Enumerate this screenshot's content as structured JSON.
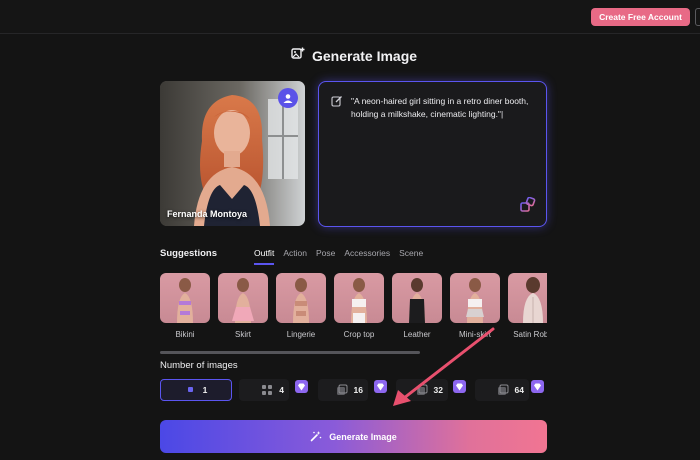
{
  "header": {
    "cta_label": "Create Free Account"
  },
  "page": {
    "title": "Generate Image"
  },
  "character": {
    "name": "Fernanda Montoya"
  },
  "prompt": {
    "text": "\"A neon-haired girl sitting in a retro diner booth, holding a milkshake, cinematic lighting.\"|"
  },
  "suggestions": {
    "label": "Suggestions",
    "tabs": [
      "Outfit",
      "Action",
      "Pose",
      "Accessories",
      "Scene"
    ],
    "active_tab": "Outfit",
    "items": [
      "Bikini",
      "Skirt",
      "Lingerie",
      "Crop top",
      "Leather",
      "Mini-skirt",
      "Satin Robe"
    ]
  },
  "num_images": {
    "label": "Number of images",
    "options": [
      "1",
      "4",
      "16",
      "32",
      "64"
    ],
    "selected": "1"
  },
  "generate": {
    "label": "Generate Image"
  },
  "colors": {
    "accent": "#5b55f0",
    "cta": "#e86a86",
    "annotation_arrow": "#e8506e"
  }
}
